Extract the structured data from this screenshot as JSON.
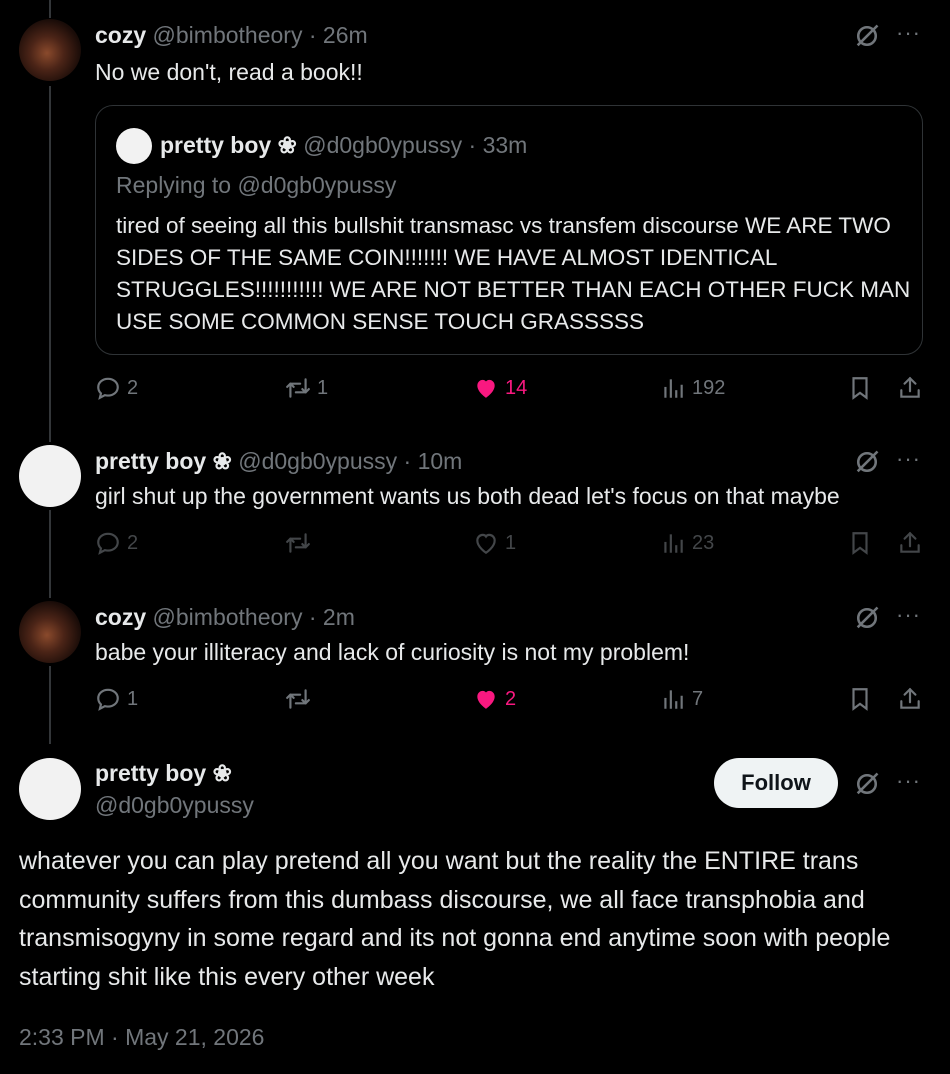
{
  "tweets": [
    {
      "name": "cozy",
      "handle": "@bimbotheory",
      "time": "26m",
      "text": "No we don't, read a book!!",
      "quote": {
        "name": "pretty boy ❀",
        "handle": "@d0gb0ypussy",
        "time": "33m",
        "replying": "Replying to @d0gb0ypussy",
        "text": "tired of seeing all this bullshit transmasc vs transfem discourse WE ARE TWO SIDES OF THE SAME COIN!!!!!!! WE HAVE ALMOST IDENTICAL STRUGGLES!!!!!!!!!!! WE ARE NOT BETTER THAN EACH OTHER FUCK MAN USE SOME COMMON SENSE TOUCH GRASSSSS"
      },
      "replies": "2",
      "reposts": "1",
      "likes": "14",
      "views": "192",
      "liked": true
    },
    {
      "name": "pretty boy ❀",
      "handle": "@d0gb0ypussy",
      "time": "10m",
      "text": "girl shut up the government wants us both dead let's focus on that maybe",
      "replies": "2",
      "reposts": "",
      "likes": "1",
      "views": "23",
      "liked": false
    },
    {
      "name": "cozy",
      "handle": "@bimbotheory",
      "time": "2m",
      "text": "babe your illiteracy and lack of curiosity is not my problem!",
      "replies": "1",
      "reposts": "",
      "likes": "2",
      "views": "7",
      "liked": true
    }
  ],
  "main": {
    "name": "pretty boy ❀",
    "handle": "@d0gb0ypussy",
    "follow_label": "Follow",
    "text": "whatever you can play pretend all you want but the reality the ENTIRE trans community suffers from this dumbass discourse, we all face transphobia and transmisogyny in some regard and its not gonna end anytime soon with people starting shit like this every other week",
    "timestamp": "2:33 PM · May 21, 2026"
  },
  "icons": {
    "more": "more-icon",
    "grok": "grok-icon",
    "reply": "reply-icon",
    "repost": "repost-icon",
    "like": "heart-icon",
    "views": "views-icon",
    "bookmark": "bookmark-icon",
    "share": "share-icon"
  },
  "colors": {
    "like": "#f91880",
    "muted": "#71767b",
    "text": "#e7e9ea",
    "bg": "#000000"
  }
}
